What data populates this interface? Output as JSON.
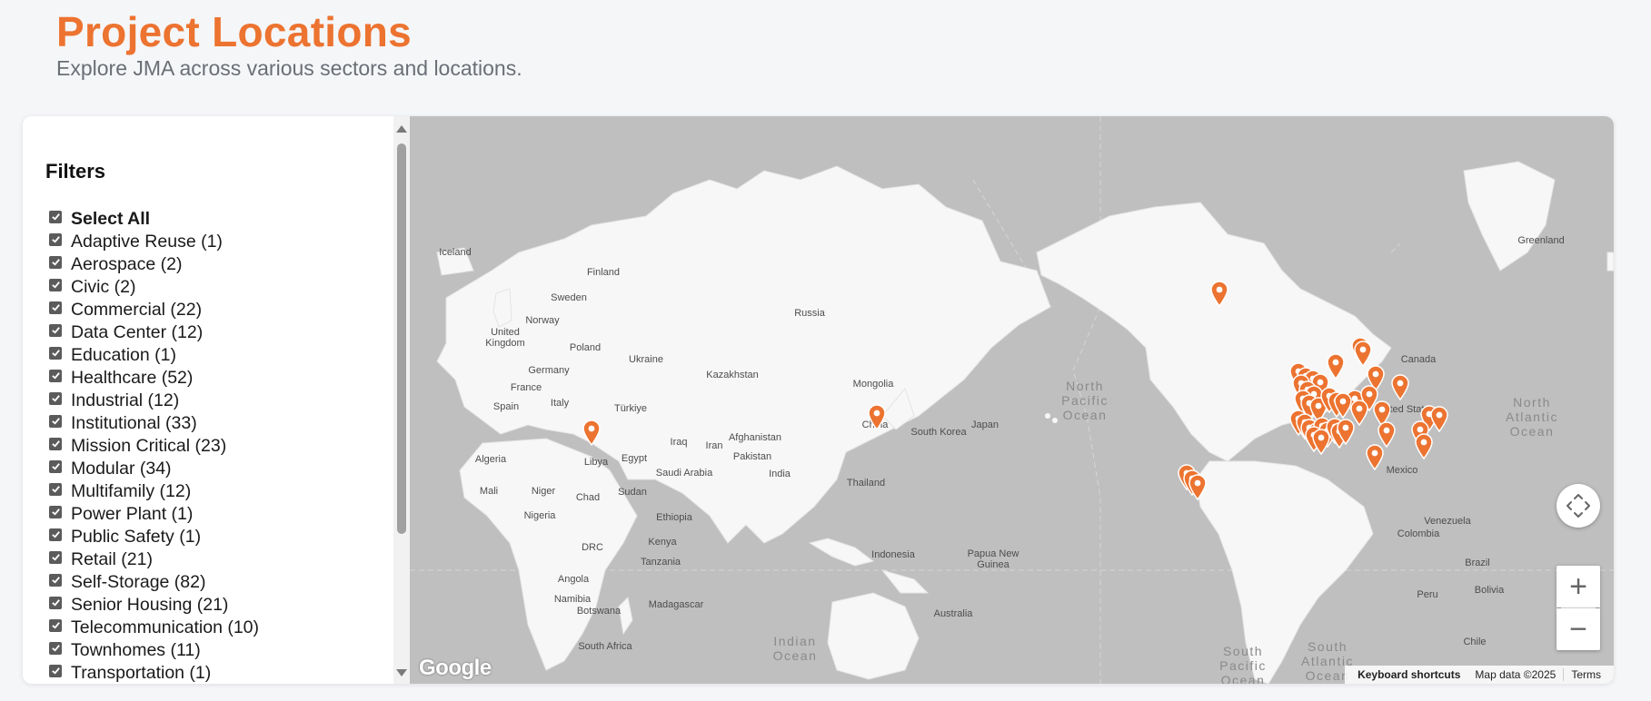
{
  "page": {
    "title": "Project Locations",
    "subtitle": "Explore JMA across various sectors and locations."
  },
  "filters": {
    "heading": "Filters",
    "items": [
      {
        "label": "Select All",
        "checked": true,
        "bold": true
      },
      {
        "label": "Adaptive Reuse (1)",
        "checked": true
      },
      {
        "label": "Aerospace (2)",
        "checked": true
      },
      {
        "label": "Civic (2)",
        "checked": true
      },
      {
        "label": "Commercial (22)",
        "checked": true
      },
      {
        "label": "Data Center (12)",
        "checked": true
      },
      {
        "label": "Education (1)",
        "checked": true
      },
      {
        "label": "Healthcare (52)",
        "checked": true
      },
      {
        "label": "Industrial (12)",
        "checked": true
      },
      {
        "label": "Institutional (33)",
        "checked": true
      },
      {
        "label": "Mission Critical (23)",
        "checked": true
      },
      {
        "label": "Modular (34)",
        "checked": true
      },
      {
        "label": "Multifamily (12)",
        "checked": true
      },
      {
        "label": "Power Plant (1)",
        "checked": true
      },
      {
        "label": "Public Safety (1)",
        "checked": true
      },
      {
        "label": "Retail (21)",
        "checked": true
      },
      {
        "label": "Self-Storage (82)",
        "checked": true
      },
      {
        "label": "Senior Housing (21)",
        "checked": true
      },
      {
        "label": "Telecommunication (10)",
        "checked": true
      },
      {
        "label": "Townhomes (11)",
        "checked": true
      },
      {
        "label": "Transportation (1)",
        "checked": true
      }
    ]
  },
  "map": {
    "marker_color": "#ec7330",
    "country_labels": [
      "Finland",
      "Sweden",
      "Norway",
      "United\nKingdom",
      "Poland",
      "Ukraine",
      "Germany",
      "France",
      "Spain",
      "Italy",
      "Türkiye",
      "Russia",
      "Kazakhstan",
      "Mongolia",
      "China",
      "Japan",
      "South Korea",
      "Iraq",
      "Iran",
      "Afghanistan",
      "Pakistan",
      "India",
      "Thailand",
      "Egypt",
      "Saudi Arabia",
      "Algeria",
      "Libya",
      "Mali",
      "Niger",
      "Chad",
      "Sudan",
      "Nigeria",
      "Ethiopia",
      "Kenya",
      "DRC",
      "Tanzania",
      "Angola",
      "Namibia",
      "Botswana",
      "Madagascar",
      "Indonesia",
      "Papua New\nGuinea",
      "Australia",
      "Iceland",
      "Greenland",
      "Canada",
      "United States",
      "Mexico",
      "Venezuela",
      "Colombia",
      "Brazil",
      "Peru",
      "Bolivia",
      "Chile",
      "South Africa"
    ],
    "ocean_labels": [
      "North\nPacific\nOcean",
      "North\nAtlantic\nOcean",
      "Indian\nOcean",
      "South\nAtlantic\nOcean",
      "South\nPacific\nOcean"
    ],
    "controls": {
      "camera_icon": "camera-control-icon",
      "zoom_in": "+",
      "zoom_out": "−"
    },
    "google_logo": "Google",
    "attribution": {
      "keyboard": "Keyboard shortcuts",
      "data": "Map data ©2025",
      "terms": "Terms"
    }
  }
}
